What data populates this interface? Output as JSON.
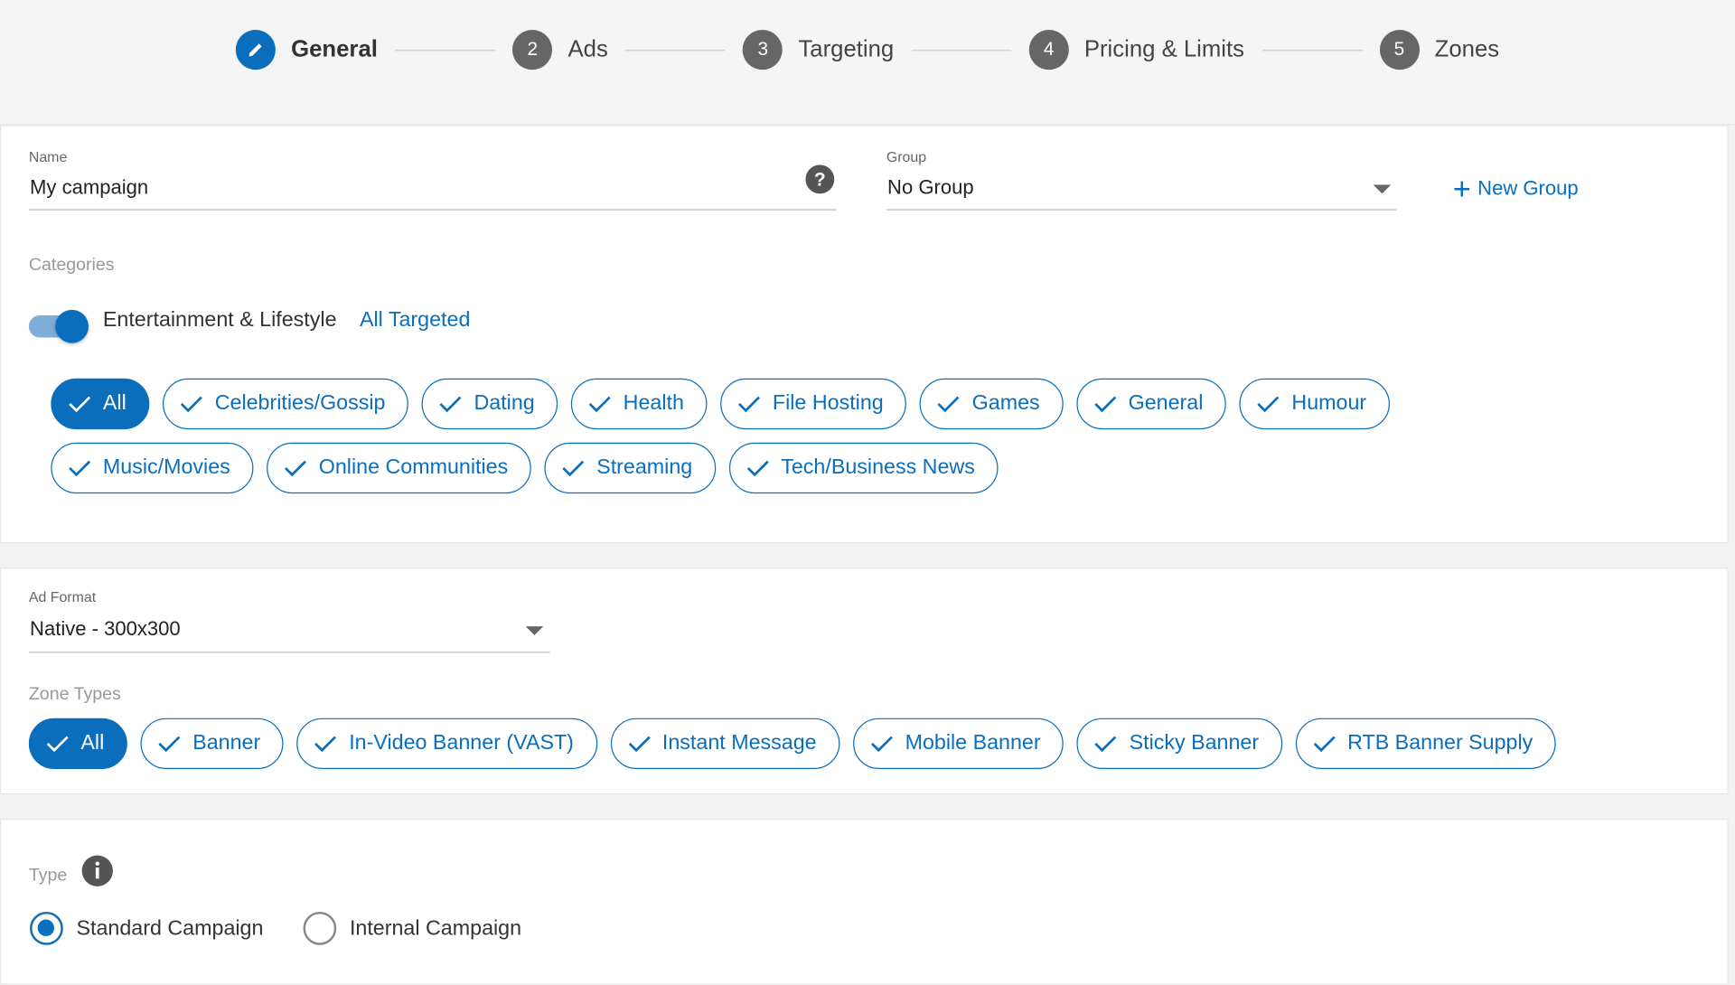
{
  "colors": {
    "accent": "#0a6ebd"
  },
  "steps": [
    {
      "num": "",
      "label": "General",
      "icon": "pencil-icon",
      "active": true
    },
    {
      "num": "2",
      "label": "Ads"
    },
    {
      "num": "3",
      "label": "Targeting"
    },
    {
      "num": "4",
      "label": "Pricing & Limits"
    },
    {
      "num": "5",
      "label": "Zones"
    }
  ],
  "name": {
    "label": "Name",
    "value": "My campaign",
    "help_icon": "help-icon"
  },
  "group": {
    "label": "Group",
    "value": "No Group",
    "new_group": "New Group"
  },
  "categories": {
    "label": "Categories",
    "toggle_on": true,
    "parent": "Entertainment & Lifestyle",
    "status": "All Targeted",
    "chips": [
      "All",
      "Celebrities/Gossip",
      "Dating",
      "Health",
      "File Hosting",
      "Games",
      "General",
      "Humour",
      "Music/Movies",
      "Online Communities",
      "Streaming",
      "Tech/Business News"
    ]
  },
  "ad_format": {
    "label": "Ad Format",
    "value": "Native - 300x300"
  },
  "zone_types": {
    "label": "Zone Types",
    "chips": [
      "All",
      "Banner",
      "In-Video Banner (VAST)",
      "Instant Message",
      "Mobile Banner",
      "Sticky Banner",
      "RTB Banner Supply"
    ]
  },
  "type": {
    "label": "Type",
    "info_icon": "info-icon",
    "options": [
      {
        "label": "Standard Campaign",
        "selected": true
      },
      {
        "label": "Internal Campaign",
        "selected": false
      }
    ]
  }
}
